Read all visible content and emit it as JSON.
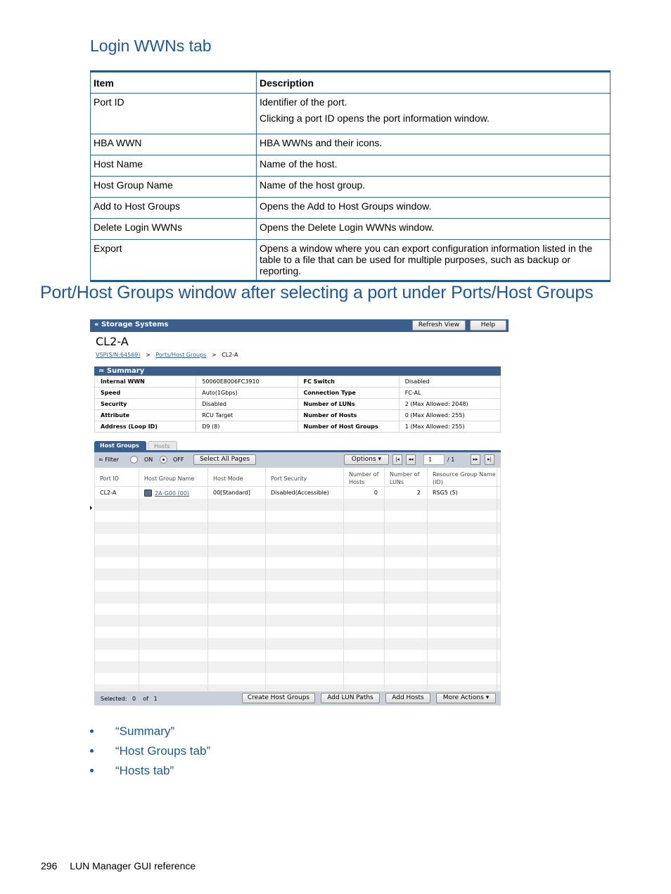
{
  "section1": {
    "heading": "Login WWNs tab",
    "table": {
      "headers": [
        "Item",
        "Description"
      ],
      "rows": [
        {
          "item": "Port ID",
          "desc": [
            "Identifier of the port.",
            "Clicking a port ID opens the port information window."
          ]
        },
        {
          "item": "HBA WWN",
          "desc": [
            "HBA WWNs and their icons."
          ]
        },
        {
          "item": "Host Name",
          "desc": [
            "Name of the host."
          ]
        },
        {
          "item": "Host Group Name",
          "desc": [
            "Name of the host group."
          ]
        },
        {
          "item": "Add to Host Groups",
          "desc": [
            "Opens the Add to Host Groups window."
          ]
        },
        {
          "item": "Delete Login WWNs",
          "desc": [
            "Opens the Delete Login WWNs window."
          ]
        },
        {
          "item": "Export",
          "desc": [
            "Opens a window where you can export configuration information listed in the table to a file that can be used for multiple purposes, such as backup or reporting."
          ]
        }
      ]
    }
  },
  "section2": {
    "heading": "Port/Host Groups window after selecting a port under Ports/Host Groups"
  },
  "window": {
    "topbar_label": "« Storage Systems",
    "refresh_label": "Refresh View",
    "help_label": "Help",
    "port_title": "CL2-A",
    "breadcrumb": [
      "VSP(S/N:64569)",
      "Ports/Host Groups",
      "CL2-A"
    ],
    "breadcrumb_sep": ">",
    "summary_label": "Summary",
    "summary": [
      {
        "k1": "Internal WWN",
        "v1": "50060E8006FC3910",
        "k2": "FC Switch",
        "v2": "Disabled"
      },
      {
        "k1": "Speed",
        "v1": "Auto(1Gbps)",
        "k2": "Connection Type",
        "v2": "FC-AL"
      },
      {
        "k1": "Security",
        "v1": "Disabled",
        "k2": "Number of LUNs",
        "v2": "2 (Max Allowed: 2048)"
      },
      {
        "k1": "Attribute",
        "v1": "RCU Target",
        "k2": "Number of Hosts",
        "v2": "0 (Max Allowed: 255)"
      },
      {
        "k1": "Address (Loop ID)",
        "v1": "D9 (8)",
        "k2": "Number of Host Groups",
        "v2": "1 (Max Allowed: 255)"
      }
    ],
    "tabs": [
      "Host Groups",
      "Hosts"
    ],
    "toolbar": {
      "filter_label": "Filter",
      "on_label": "ON",
      "off_label": "OFF",
      "select_all_label": "Select All Pages",
      "options_label": "Options",
      "page_value": "1",
      "page_total": "/ 1"
    },
    "columns": [
      "Port ID",
      "Host Group Name",
      "Host Mode",
      "Port Security",
      "Number of Hosts",
      "Number of LUNs",
      "Resource Group Name (ID)"
    ],
    "rows": [
      {
        "port_id": "CL2-A",
        "host_group": "2A-G00 (00)",
        "host_mode": "00[Standard]",
        "port_security": "Disabled(Accessible)",
        "hosts": "0",
        "luns": "2",
        "rsg": "RSG5 (5)"
      }
    ],
    "footer": {
      "selected_label": "Selected:",
      "selected_count": "0",
      "of_label": "of",
      "total": "1",
      "buttons": [
        "Create Host Groups",
        "Add LUN Paths",
        "Add Hosts",
        "More Actions"
      ]
    }
  },
  "bullets": [
    "“Summary”",
    "“Host Groups tab”",
    "“Hosts tab”"
  ],
  "page_footer": {
    "page_number": "296",
    "title": "LUN Manager GUI reference"
  }
}
